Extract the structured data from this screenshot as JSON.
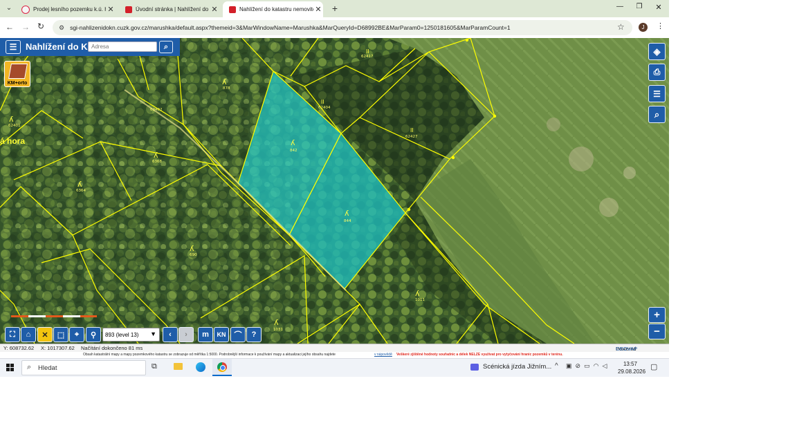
{
  "browser": {
    "tabs": [
      {
        "title": "Prodej lesního pozemku k.ú. Hrá",
        "active": false
      },
      {
        "title": "Úvodní stránka | Nahlížení do k",
        "active": false
      },
      {
        "title": "Nahlížení do katastru nemovitos",
        "active": true
      }
    ],
    "url": "sgi-nahlizenidokn.cuzk.gov.cz/marushka/default.aspx?themeid=3&MarWindowName=Marushka&MarQueryId=D68992BE&MarParam0=1250181605&MarParamCount=1",
    "profile_initial": "J"
  },
  "app": {
    "title": "Nahlížení do KN",
    "search_placeholder": "Adresa",
    "km_orto_label": "KM+orto",
    "place_label": "á hora",
    "scale_select": "893 (level 13)",
    "kn_button": "KN"
  },
  "parcels": {
    "highlighted": [
      "842",
      "844"
    ],
    "labels": [
      "62417",
      "878",
      "62404",
      "62427",
      "62401",
      "62402",
      "6368",
      "6364",
      "690",
      "1011",
      "1011",
      "1031"
    ]
  },
  "status": {
    "y_coord": "Y: 608732.62",
    "x_coord": "X: 1017307.62",
    "loading": "Načítání dokončeno 81 ms",
    "powered_by_prefix": "Powered by ",
    "powered_by_brand": "GEOVAP"
  },
  "legal": {
    "text": "Obsah katastrální mapy a mapy pozemkového katastru se zobrazuje od měřítka 1:5000. Podrobnější informace k používání mapy a aktualizaci jejího obsahu najdete",
    "link": "v nápovědě",
    "warning": "Veškeré zjištěné hodnoty souřadnic a délek NELZE využívat pro vytyčování hranic pozemků v terénu."
  },
  "taskbar": {
    "search_label": "Hledat",
    "media_title": "Scénická jízda Jižním...",
    "time": "13:57",
    "date": "29.08.2026"
  },
  "colors": {
    "brand_blue": "#1f5da8",
    "parcel_line": "#ffff00",
    "highlight_fill": "#22c8c8",
    "warning_red": "#e0261b"
  }
}
